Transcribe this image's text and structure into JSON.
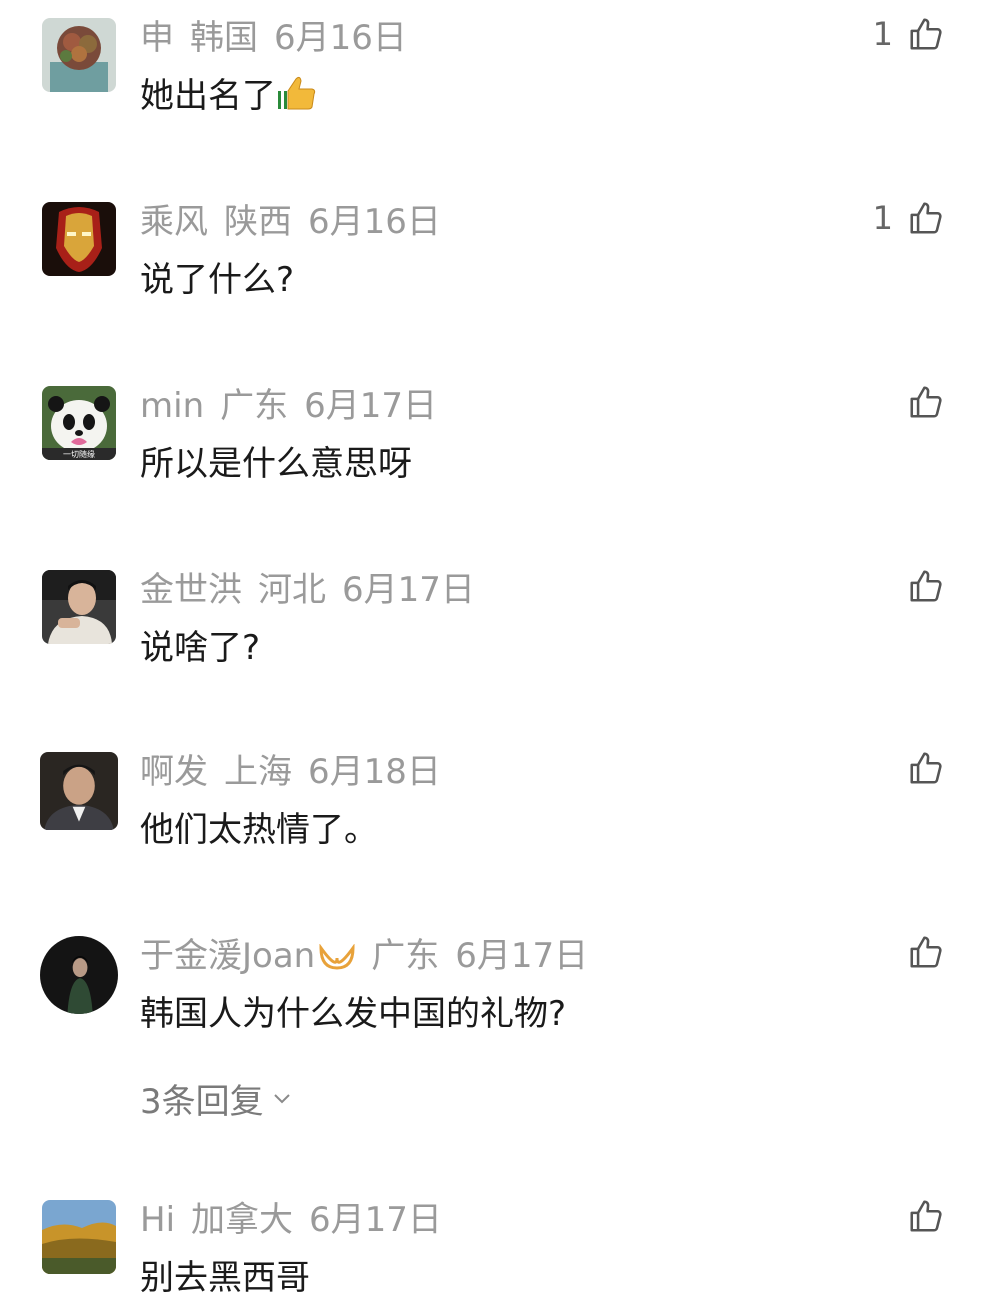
{
  "comments": [
    {
      "user": "申",
      "location": "韩国",
      "date": "6月16日",
      "text": "她出名了",
      "likes": "1",
      "avatar_icon": "succulent-plant-avatar"
    },
    {
      "user": "乘风",
      "location": "陕西",
      "date": "6月16日",
      "text": "说了什么?",
      "likes": "1",
      "avatar_icon": "iron-man-avatar"
    },
    {
      "user": "min",
      "location": "广东",
      "date": "6月17日",
      "text": "所以是什么意思呀",
      "likes": "",
      "avatar_icon": "panda-avatar",
      "avatar_caption": "一切随缘"
    },
    {
      "user": "金世洪",
      "location": "河北",
      "date": "6月17日",
      "text": "说啥了?",
      "likes": "",
      "avatar_icon": "man-portrait-avatar"
    },
    {
      "user": "啊发",
      "location": "上海",
      "date": "6月18日",
      "text": "他们太热情了。",
      "likes": "",
      "avatar_icon": "man-suit-avatar"
    },
    {
      "user": "于金湲Joan",
      "location": "广东",
      "date": "6月17日",
      "text": "韩国人为什么发中国的礼物?",
      "likes": "",
      "avatar_icon": "woman-dark-avatar",
      "replies": "3条回复"
    },
    {
      "user": "Hi",
      "location": "加拿大",
      "date": "6月17日",
      "text": "别去黑西哥",
      "likes": "",
      "avatar_icon": "autumn-landscape-avatar"
    }
  ],
  "colors": {
    "meta": "#9a9a9a",
    "text": "#1a1a1a",
    "badge": "#e8a23a"
  }
}
